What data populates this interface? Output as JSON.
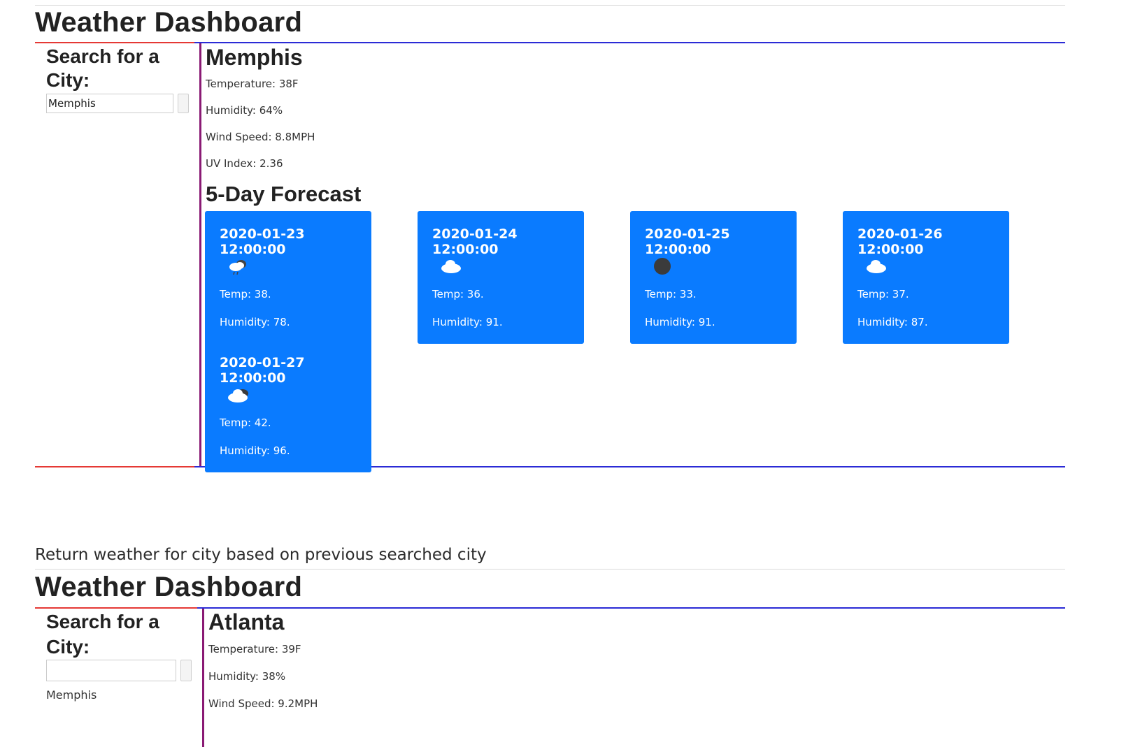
{
  "screen1": {
    "title": "Weather Dashboard",
    "search": {
      "heading_line1": "Search for a",
      "heading_line2": "City:",
      "input_value": "Memphis"
    },
    "current": {
      "city": "Memphis",
      "temperature": "Temperature: 38F",
      "humidity": "Humidity: 64%",
      "wind": "Wind Speed: 8.8MPH",
      "uv": "UV Index: 2.36"
    },
    "forecast_title": "5-Day Forecast",
    "forecast": [
      {
        "date": "2020-01-23 12:00:00",
        "icon": "rain-cloud-icon",
        "temp": "Temp: 38.",
        "humidity": "Humidity: 78."
      },
      {
        "date": "2020-01-24 12:00:00",
        "icon": "cloud-icon",
        "temp": "Temp: 36.",
        "humidity": "Humidity: 91."
      },
      {
        "date": "2020-01-25 12:00:00",
        "icon": "overcast-dot-icon",
        "temp": "Temp: 33.",
        "humidity": "Humidity: 91."
      },
      {
        "date": "2020-01-26 12:00:00",
        "icon": "cloud-icon",
        "temp": "Temp: 37.",
        "humidity": "Humidity: 87."
      },
      {
        "date": "2020-01-27 12:00:00",
        "icon": "broken-clouds-icon",
        "temp": "Temp: 42.",
        "humidity": "Humidity: 96."
      }
    ]
  },
  "caption": "Return weather for city based on previous searched city",
  "screen2": {
    "title": "Weather Dashboard",
    "search": {
      "heading_line1": "Search for a",
      "heading_line2": "City:",
      "input_value": "",
      "history": [
        "Memphis"
      ]
    },
    "current": {
      "city": "Atlanta",
      "temperature": "Temperature: 39F",
      "humidity": "Humidity: 38%",
      "wind": "Wind Speed: 9.2MPH"
    }
  },
  "colors": {
    "card_bg": "#0a7bff",
    "left_border_accent": "#e53935",
    "right_border_accent": "#2b2bd6",
    "divider": "#8a1a74"
  }
}
